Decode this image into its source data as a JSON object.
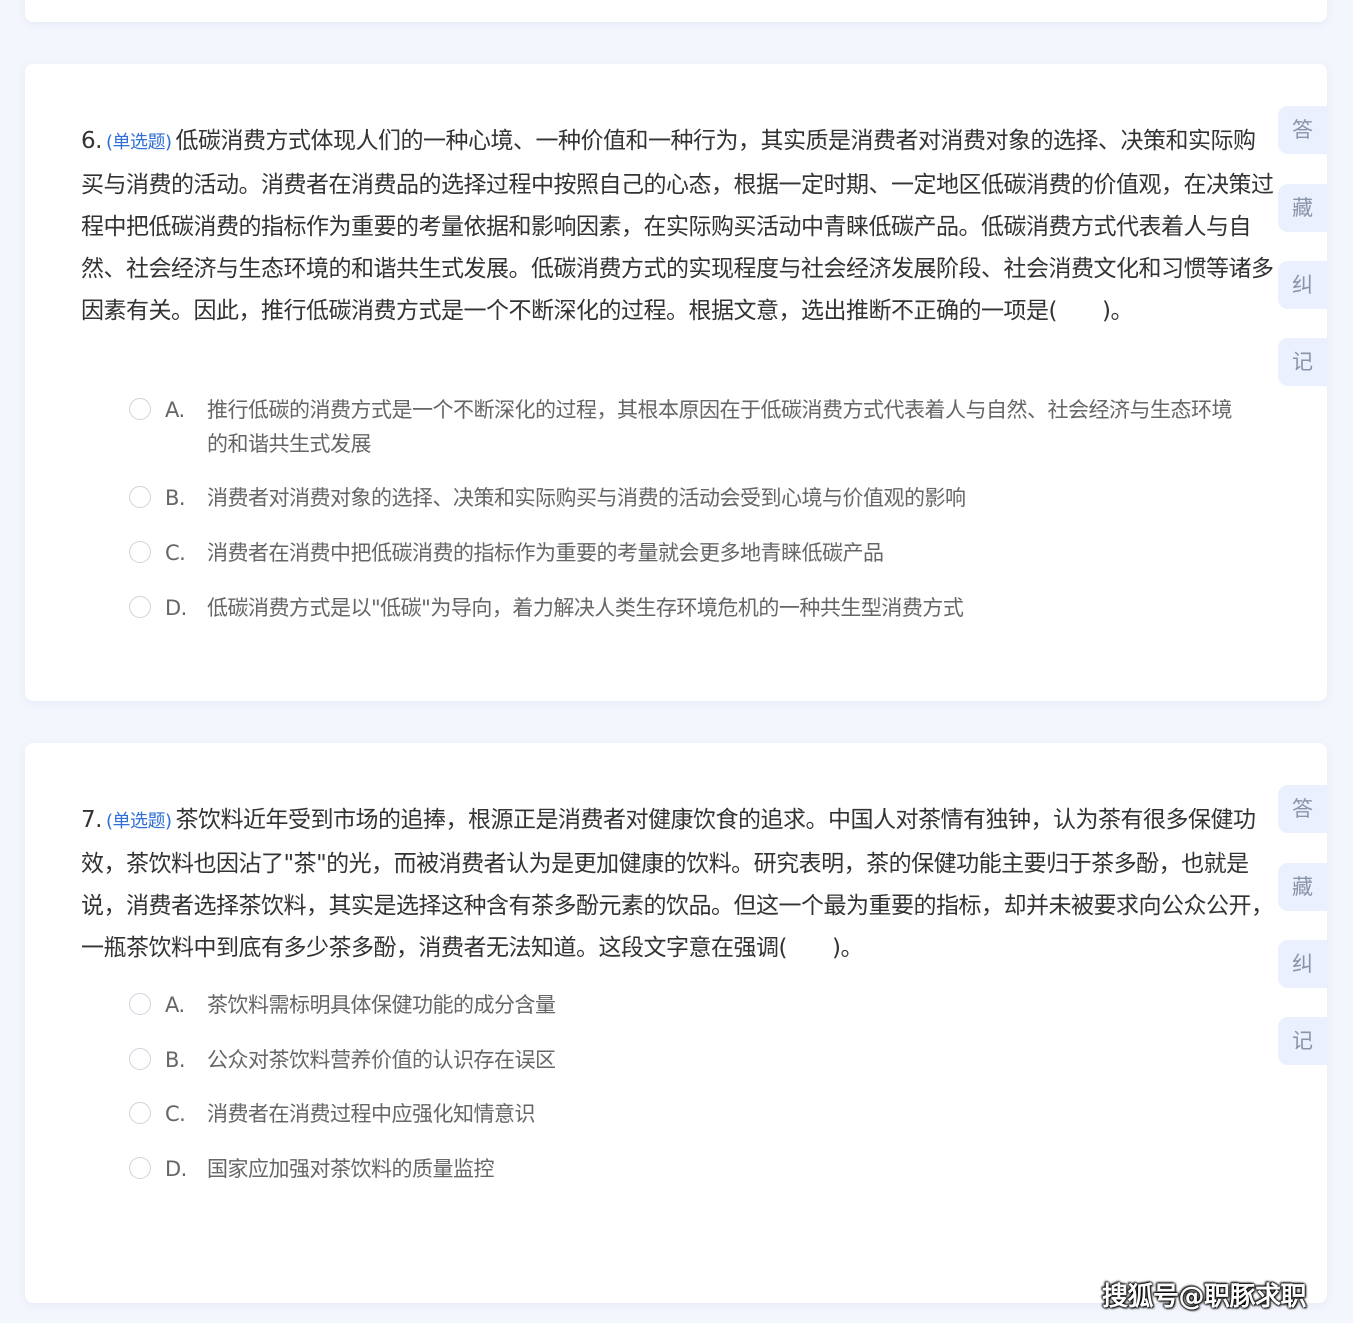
{
  "questions": [
    {
      "number": "6.",
      "type": "(单选题)",
      "text": "低碳消费方式体现人们的一种心境、一种价值和一种行为，其实质是消费者对消费对象的选择、决策和实际购买与消费的活动。消费者在消费品的选择过程中按照自己的心态，根据一定时期、一定地区低碳消费的价值观，在决策过程中把低碳消费的指标作为重要的考量依据和影响因素，在实际购买活动中青睐低碳产品。低碳消费方式代表着人与自然、社会经济与生态环境的和谐共生式发展。低碳消费方式的实现程度与社会经济发展阶段、社会消费文化和习惯等诸多因素有关。因此，推行低碳消费方式是一个不断深化的过程。根据文意，选出推断不正确的一项是(　　)。",
      "options": [
        {
          "letter": "A.",
          "text": "推行低碳的消费方式是一个不断深化的过程，其根本原因在于低碳消费方式代表着人与自然、社会经济与生态环境的和谐共生式发展"
        },
        {
          "letter": "B.",
          "text": "消费者对消费对象的选择、决策和实际购买与消费的活动会受到心境与价值观的影响"
        },
        {
          "letter": "C.",
          "text": "消费者在消费中把低碳消费的指标作为重要的考量就会更多地青睐低碳产品"
        },
        {
          "letter": "D.",
          "text": "低碳消费方式是以\"低碳\"为导向，着力解决人类生存环境危机的一种共生型消费方式"
        }
      ]
    },
    {
      "number": "7.",
      "type": "(单选题)",
      "text": "茶饮料近年受到市场的追捧，根源正是消费者对健康饮食的追求。中国人对茶情有独钟，认为茶有很多保健功效，茶饮料也因沾了\"茶\"的光，而被消费者认为是更加健康的饮料。研究表明，茶的保健功能主要归于茶多酚，也就是说，消费者选择茶饮料，其实是选择这种含有茶多酚元素的饮品。但这一个最为重要的指标，却并未被要求向公众公开，一瓶茶饮料中到底有多少茶多酚，消费者无法知道。这段文字意在强调(　　)。",
      "options": [
        {
          "letter": "A.",
          "text": "茶饮料需标明具体保健功能的成分含量"
        },
        {
          "letter": "B.",
          "text": "公众对茶饮料营养价值的认识存在误区"
        },
        {
          "letter": "C.",
          "text": "消费者在消费过程中应强化知情意识"
        },
        {
          "letter": "D.",
          "text": "国家应加强对茶饮料的质量监控"
        }
      ]
    }
  ],
  "side_actions": {
    "answer": "答",
    "favorite": "藏",
    "correct": "纠",
    "note": "记"
  },
  "watermark": "搜狐号@职豚求职"
}
